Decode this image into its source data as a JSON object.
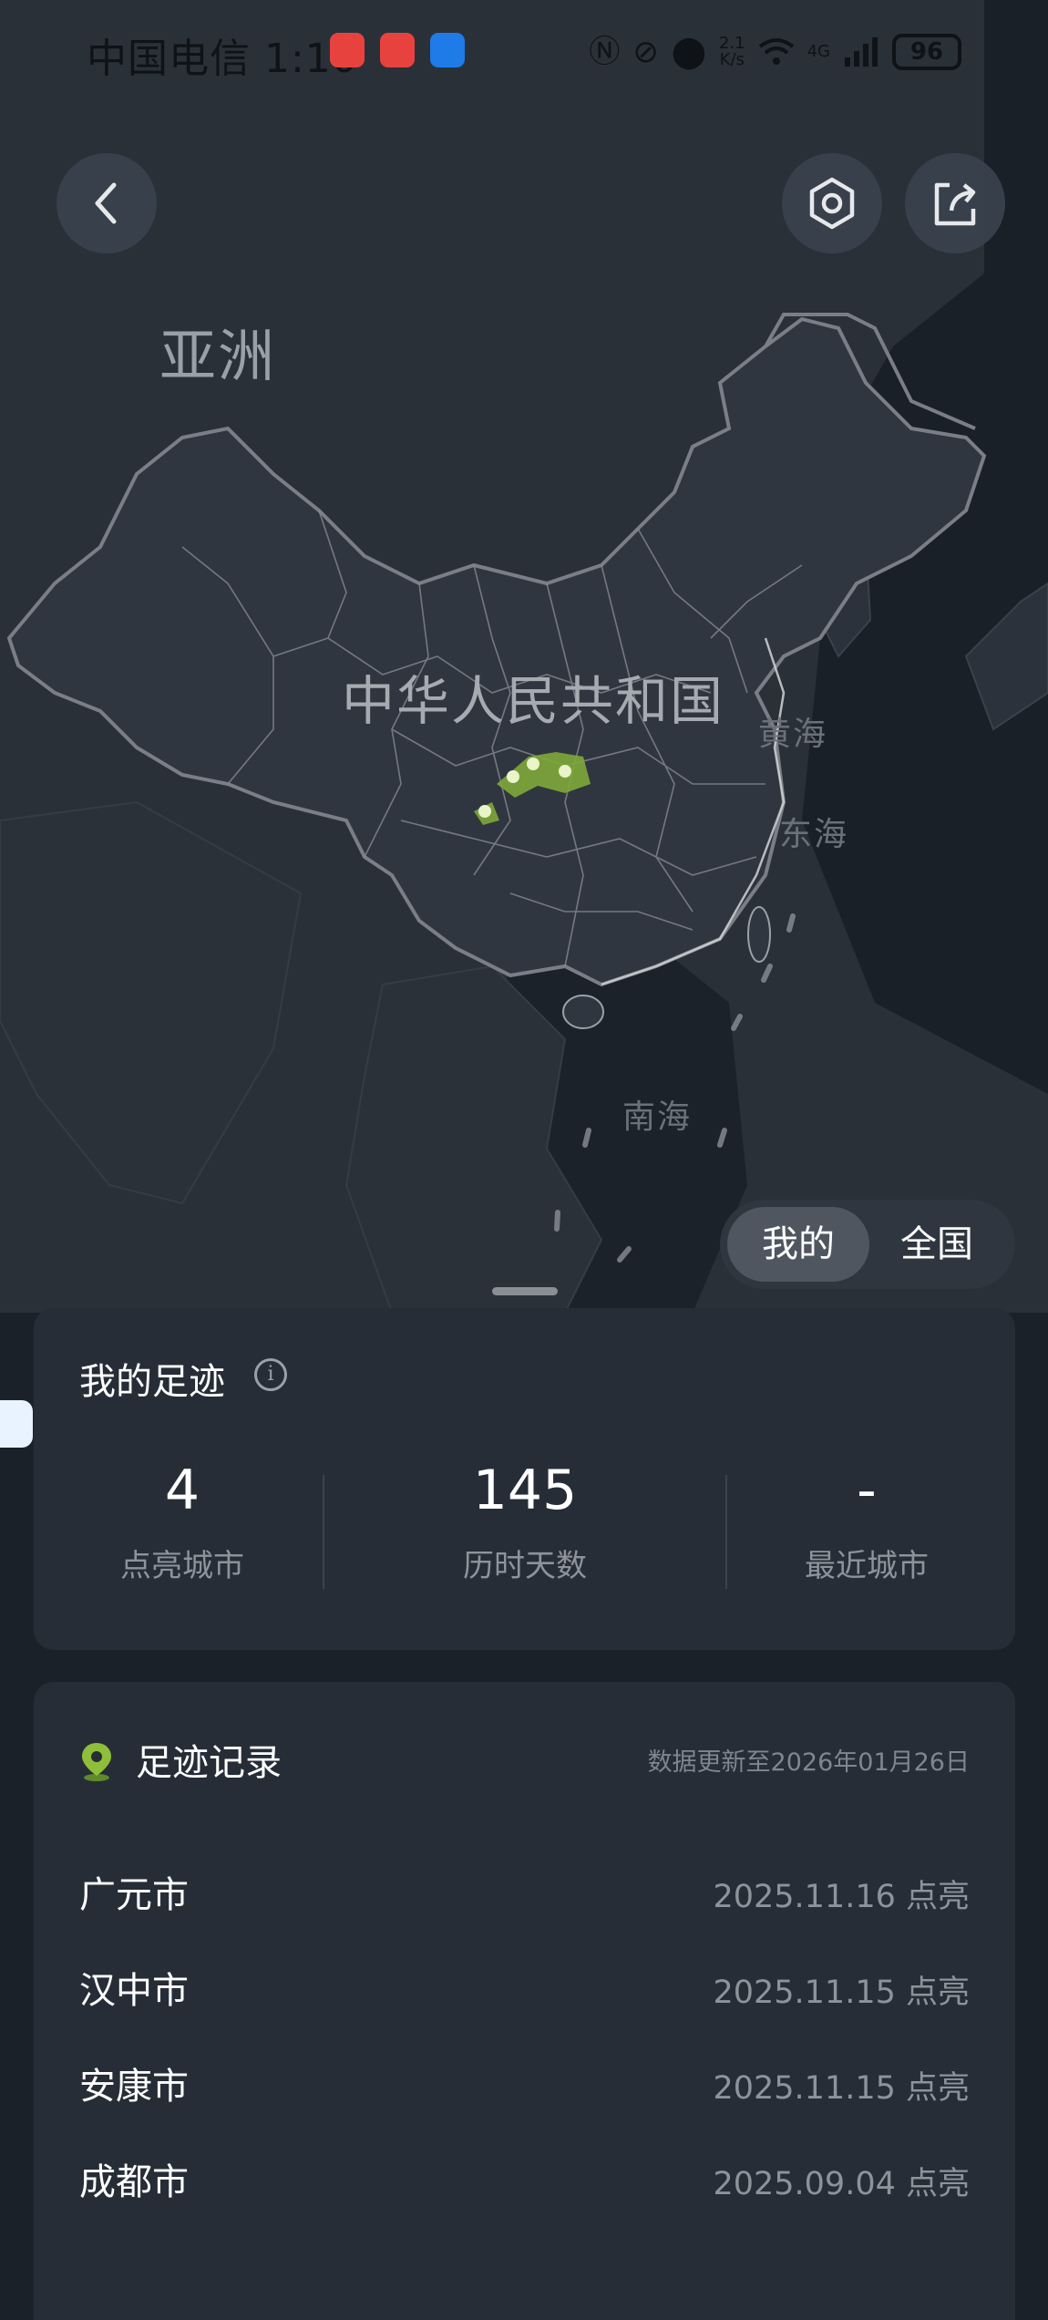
{
  "status_bar": {
    "carrier_time": "中国电信 1:10",
    "speed_top": "2.1",
    "speed_bottom": "K/s",
    "network": "4G",
    "battery": "96",
    "icons": [
      "nfc-icon",
      "mute-icon",
      "location-icon",
      "wifi-icon",
      "signal-icon",
      "battery-icon"
    ]
  },
  "map": {
    "continent_label": "亚洲",
    "country_label": "中华人民共和国",
    "sea_labels": [
      "黄海",
      "东海",
      "南海"
    ],
    "highlight_color": "#8fbf3a"
  },
  "toolbar": {
    "back_icon": "back-arrow-icon",
    "settings_icon": "hexagon-settings-icon",
    "share_icon": "share-icon"
  },
  "scope_toggle": {
    "options": [
      "我的",
      "全国"
    ],
    "selected": "我的"
  },
  "footprint": {
    "title": "我的足迹",
    "stats": [
      {
        "value": "4",
        "label": "点亮城市"
      },
      {
        "value": "145",
        "label": "历时天数"
      },
      {
        "value": "-",
        "label": "最近城市"
      }
    ]
  },
  "records": {
    "title": "足迹记录",
    "update_note": "数据更新至2026年01月26日",
    "items": [
      {
        "city": "广元市",
        "date": "2025.11.16 点亮"
      },
      {
        "city": "汉中市",
        "date": "2025.11.15 点亮"
      },
      {
        "city": "安康市",
        "date": "2025.11.15 点亮"
      },
      {
        "city": "成都市",
        "date": "2025.09.04 点亮"
      }
    ]
  }
}
